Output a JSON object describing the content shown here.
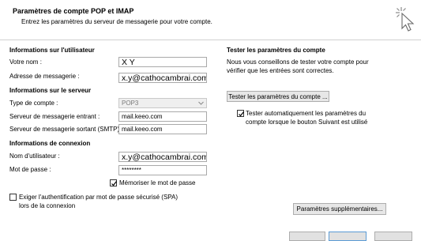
{
  "header": {
    "title": "Paramètres de compte POP et IMAP",
    "subtitle": "Entrez les paramètres du serveur de messagerie pour votre compte."
  },
  "user_info": {
    "heading": "Informations sur l'utilisateur",
    "name_label": "Votre nom :",
    "name_value": "X  Y",
    "email_label": "Adresse de messagerie :",
    "email_value": "x.y@cathocambrai.com"
  },
  "server_info": {
    "heading": "Informations sur le serveur",
    "account_type_label": "Type de compte :",
    "account_type_value": "POP3",
    "incoming_label": "Serveur de messagerie entrant :",
    "incoming_value": "mail.keeo.com",
    "outgoing_label": "Serveur de messagerie sortant (SMTP) :",
    "outgoing_value": "mail.keeo.com"
  },
  "login_info": {
    "heading": "Informations de connexion",
    "username_label": "Nom d'utilisateur :",
    "username_value": "x.y@cathocambrai.com",
    "password_label": "Mot de passe :",
    "password_value": "********",
    "remember_password_label": "Mémoriser le mot de passe",
    "remember_password_checked": true,
    "spa_label_line1": "Exiger l'authentification par mot de passe sécurisé (SPA)",
    "spa_label_line2": "lors de la connexion",
    "spa_checked": false
  },
  "test_settings": {
    "heading": "Tester les paramètres du compte",
    "description_line1": "Nous vous conseillons de tester votre compte pour",
    "description_line2": "vérifier que les entrées sont correctes.",
    "test_button_label": "Tester les paramètres du compte ...",
    "auto_test_line1": "Tester automatiquement les paramètres du",
    "auto_test_line2": "compte lorsque le bouton Suivant est utilisé",
    "auto_test_checked": true
  },
  "more_settings_button_label": "Paramètres supplémentaires..."
}
